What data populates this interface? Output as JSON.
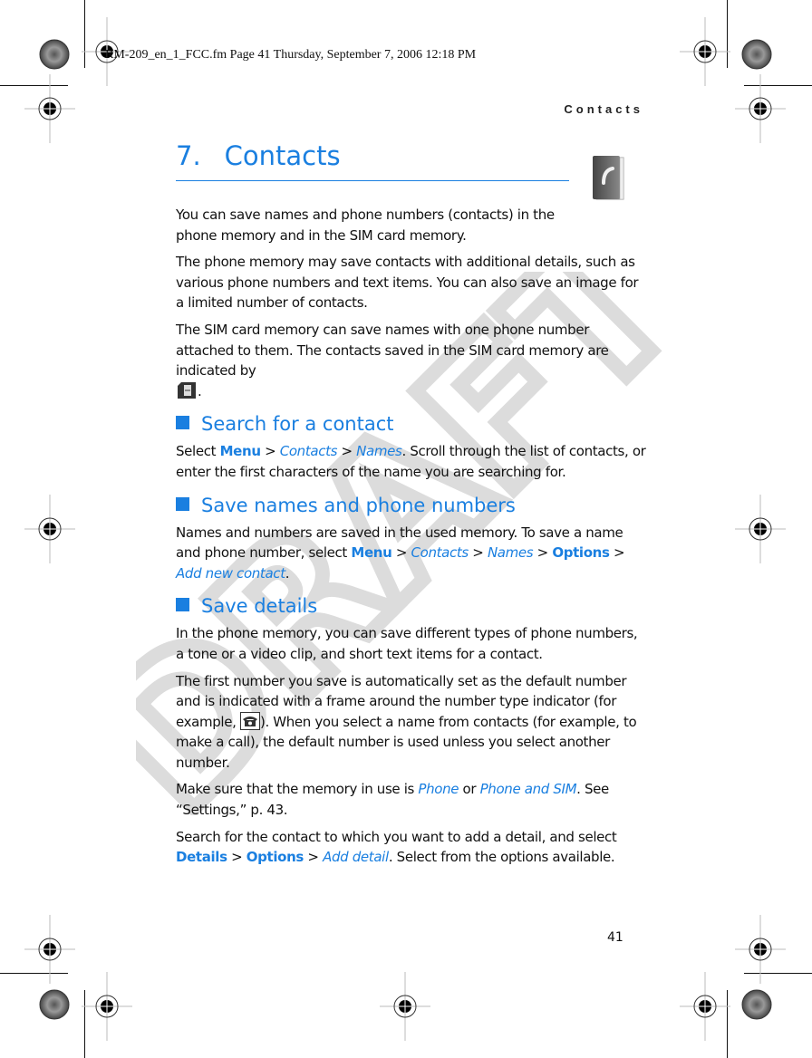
{
  "print_header": "RM-209_en_1_FCC.fm  Page 41  Thursday, September 7, 2006  12:18 PM",
  "running_head": "Contacts",
  "watermark": "DRAFT",
  "chapter": {
    "number": "7.",
    "title": "Contacts",
    "icon": "contacts-book-icon"
  },
  "colors": {
    "accent": "#1a7fe0",
    "text": "#111111",
    "watermark": "#e0e0e0"
  },
  "intro": {
    "p1": "You can save names and phone numbers (contacts) in the phone memory and in the SIM card memory.",
    "p2": "The phone memory may save contacts with additional details, such as various phone numbers and text items. You can also save an image for a limited number of contacts.",
    "p3": "The SIM card memory can save names with one phone number attached to them. The contacts saved in the SIM card memory are indicated by",
    "p3_end": "."
  },
  "sections": [
    {
      "heading": "Search for a contact",
      "text": {
        "a": "Select ",
        "menu": "Menu",
        "sep": " > ",
        "contacts": "Contacts",
        "names": "Names",
        "b": ". Scroll through the list of contacts, or enter the first characters of the name you are searching for."
      }
    },
    {
      "heading": "Save names and phone numbers",
      "text": {
        "a": "Names and numbers are saved in the used memory. To save a name and phone number, select ",
        "menu": "Menu",
        "sep": " > ",
        "contacts": "Contacts",
        "names": "Names",
        "options": "Options",
        "add_new": "Add new contact",
        "end": "."
      }
    },
    {
      "heading": "Save details",
      "p1": "In the phone memory, you can save different types of phone numbers, a tone or a video clip, and short text items for a contact.",
      "p2a": "The first number you save is automatically set as the default number and is indicated with a frame around the number type indicator (for example, ",
      "p2b": "). When you select a name from contacts (for example, to make a call), the default number is used unless you select another number.",
      "p3a": "Make sure that the memory in use is ",
      "phone": "Phone",
      "or": " or ",
      "phone_sim": "Phone and SIM",
      "p3b": ". See “Settings,” p. 43.",
      "p4a": "Search for the contact to which you want to add a detail, and select ",
      "details": "Details",
      "sep": " > ",
      "options": "Options",
      "add_detail": "Add detail",
      "p4b": ". Select from the options available."
    }
  ],
  "page_number": "41"
}
